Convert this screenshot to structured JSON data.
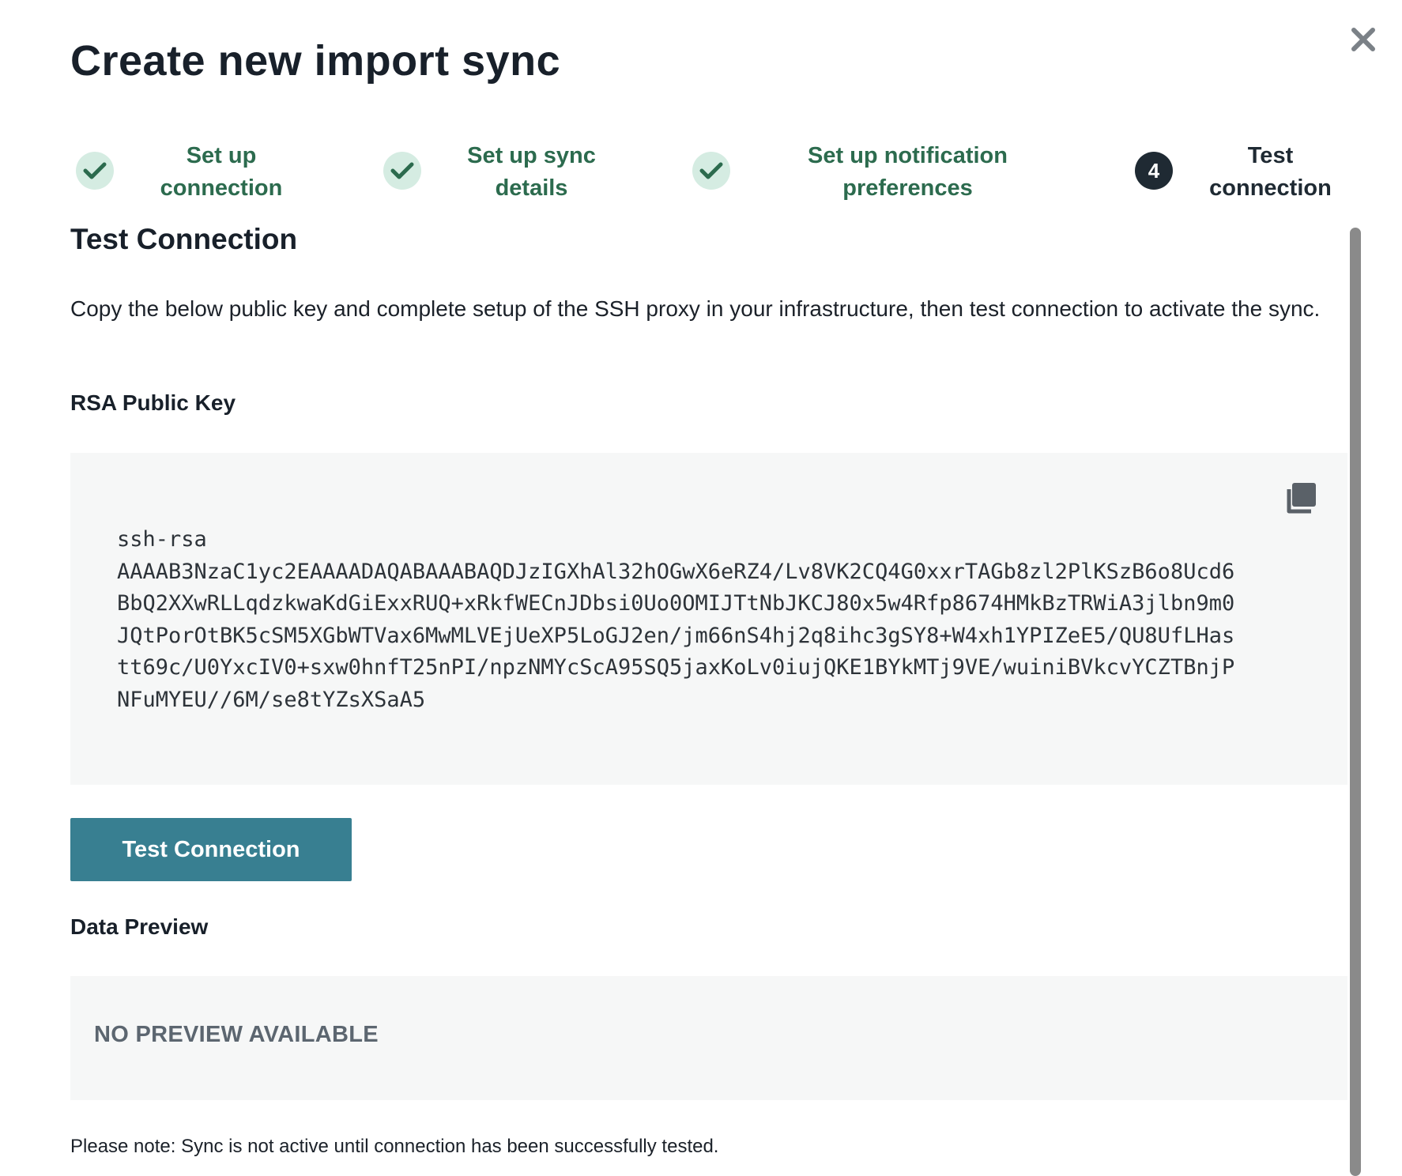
{
  "dialog": {
    "title": "Create new import sync",
    "close_icon": "close-icon"
  },
  "steps": [
    {
      "label": "Set up connection",
      "status": "complete",
      "icon": "check-icon"
    },
    {
      "label": "Set up sync details",
      "status": "complete",
      "icon": "check-icon"
    },
    {
      "label": "Set up notification preferences",
      "status": "complete",
      "icon": "check-icon"
    },
    {
      "label": "Test connection",
      "status": "current",
      "number": "4"
    }
  ],
  "section": {
    "title": "Test Connection",
    "description": "Copy the below public key and complete setup of the SSH proxy in your infrastructure, then test connection to activate the sync."
  },
  "rsa": {
    "label": "RSA Public Key",
    "key": "ssh-rsa\nAAAAB3NzaC1yc2EAAAADAQABAAABAQDJzIGXhAl32hOGwX6eRZ4/Lv8VK2CQ4G0xxrTAGb8zl2PlKSzB6o8Ucd6BbQ2XXwRLLqdzkwaKdGiExxRUQ+xRkfWECnJDbsi0Uo0OMIJTtNbJKCJ80x5w4Rfp8674HMkBzTRWiA3jlbn9m0JQtPorOtBK5cSM5XGbWTVax6MwMLVEjUeXP5LoGJ2en/jm66nS4hj2q8ihc3gSY8+W4xh1YPIZeE5/QU8UfLHastt69c/U0YxcIV0+sxw0hnfT25nPI/npzNMYcScA95SQ5jaxKoLv0iujQKE1BYkMTj9VE/wuiniBVkcvYCZTBnjPNFuMYEU//6M/se8tYZsXSaA5",
    "copy_icon": "copy-icon"
  },
  "test_button": {
    "label": "Test Connection"
  },
  "preview": {
    "label": "Data Preview",
    "empty_text": "NO PREVIEW AVAILABLE"
  },
  "note": "Please note: Sync is not active until connection has been successfully tested.",
  "colors": {
    "accent": "#387f91",
    "step_complete": "#2c6b4e",
    "check_bg": "#d5ece2",
    "panel_bg": "#f6f7f7"
  }
}
